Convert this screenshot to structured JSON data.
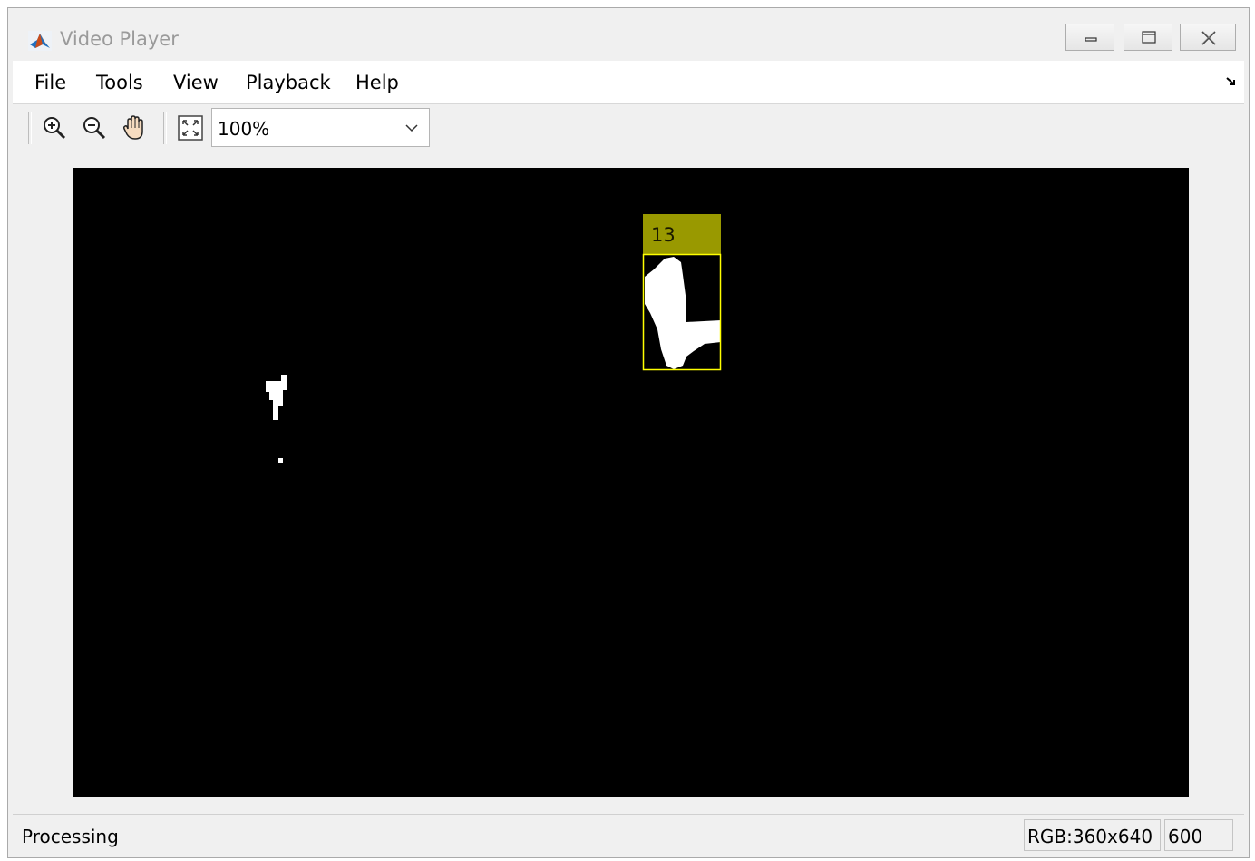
{
  "window": {
    "title": "Video Player",
    "app_icon": "matlab-logo-icon"
  },
  "title_buttons": [
    {
      "name": "minimize-icon"
    },
    {
      "name": "maximize-icon"
    },
    {
      "name": "close-icon"
    }
  ],
  "menu": {
    "items": [
      "File",
      "Tools",
      "View",
      "Playback",
      "Help"
    ],
    "corner_icon": "dock-arrow-icon"
  },
  "toolbar": {
    "icons": [
      "zoom-in-icon",
      "zoom-out-icon",
      "pan-hand-icon",
      "fit-to-window-icon"
    ],
    "zoom_value": "100%"
  },
  "video": {
    "background_color": "#000000",
    "track_label": "13",
    "label_bg_color": "#999900",
    "bbox_color": "#ffff00",
    "blob_color": "#ffffff"
  },
  "status": {
    "text": "Processing",
    "format": "RGB:360x640",
    "frame": "600"
  }
}
